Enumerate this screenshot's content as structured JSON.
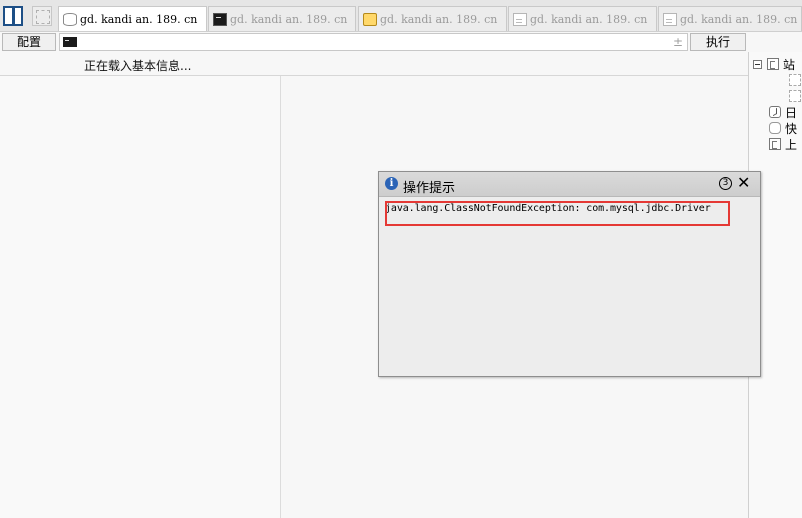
{
  "tabs": [
    {
      "label": "gd. kandi an. 189. cn",
      "icon": "database-icon",
      "active": true
    },
    {
      "label": "gd. kandi an. 189. cn",
      "icon": "terminal-icon",
      "active": false
    },
    {
      "label": "gd. kandi an. 189. cn",
      "icon": "folder-icon",
      "active": false
    },
    {
      "label": "gd. kandi an. 189. cn",
      "icon": "file-icon",
      "active": false
    },
    {
      "label": "gd. kandi an. 189. cn",
      "icon": "file-icon",
      "active": false
    }
  ],
  "toolbar": {
    "config_label": "配置",
    "command_value": "",
    "plusminus": "±",
    "execute_label": "执行"
  },
  "status": {
    "text": "正在载入基本信息..."
  },
  "sidebar": {
    "items": [
      {
        "label": "站",
        "icon": "site-icon"
      },
      {
        "label": "",
        "icon": "placeholder-icon"
      },
      {
        "label": "",
        "icon": "placeholder-icon"
      },
      {
        "label": "日",
        "icon": "clock-icon"
      },
      {
        "label": "快",
        "icon": "hand-icon"
      },
      {
        "label": "上",
        "icon": "upload-icon"
      }
    ]
  },
  "dialog": {
    "title": "操作提示",
    "info_icon": "i",
    "count": "3",
    "close": "✕",
    "message": "java.lang.ClassNotFoundException: com.mysql.jdbc.Driver",
    "highlight_color": "#e53935"
  }
}
